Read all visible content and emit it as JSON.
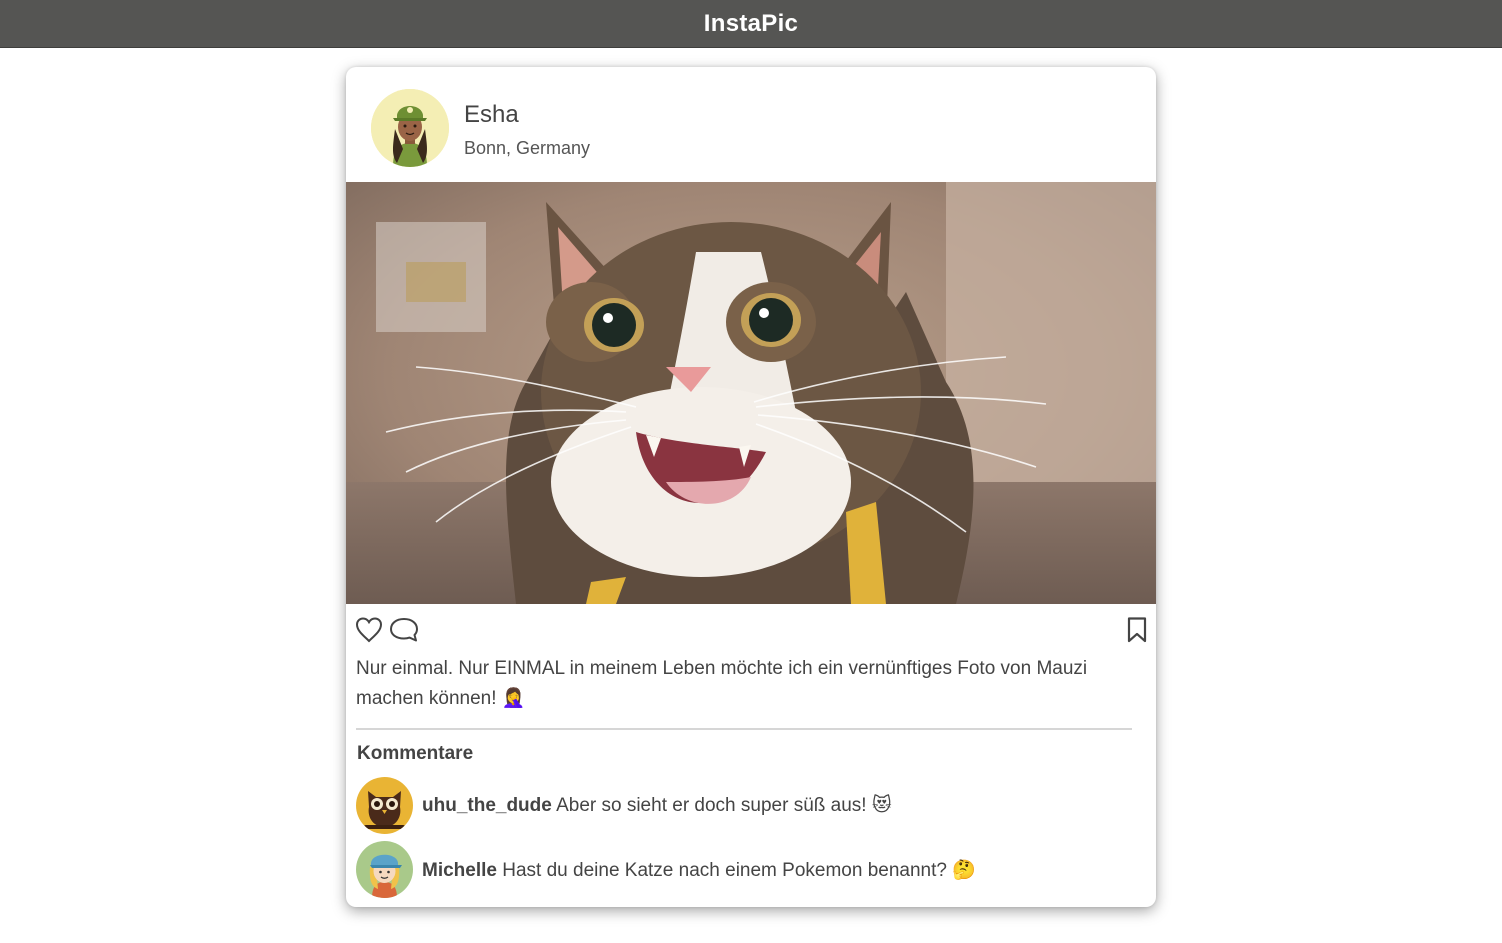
{
  "app": {
    "title": "InstaPic"
  },
  "post": {
    "user": {
      "name": "Esha",
      "location": "Bonn, Germany"
    },
    "caption": "Nur einmal. Nur EINMAL in meinem Leben möchte ich ein vernünftiges Foto von Mauzi machen können! 🤦‍♀️",
    "actions": {
      "like_icon": "heart-icon",
      "comment_icon": "comment-bubble-icon",
      "bookmark_icon": "bookmark-icon"
    }
  },
  "comments": {
    "title": "Kommentare",
    "items": [
      {
        "user": "uhu_the_dude",
        "text": "Aber so sieht er doch super süß aus! 😻",
        "avatar_bg": "#e9b434"
      },
      {
        "user": "Michelle",
        "text": "Hast du deine Katze nach einem Pokemon benannt? 🤔",
        "avatar_bg": "#a9c98a"
      }
    ]
  },
  "colors": {
    "topbar": "#555553",
    "text": "#444444",
    "avatar_esha_bg": "#f4eeb4"
  }
}
